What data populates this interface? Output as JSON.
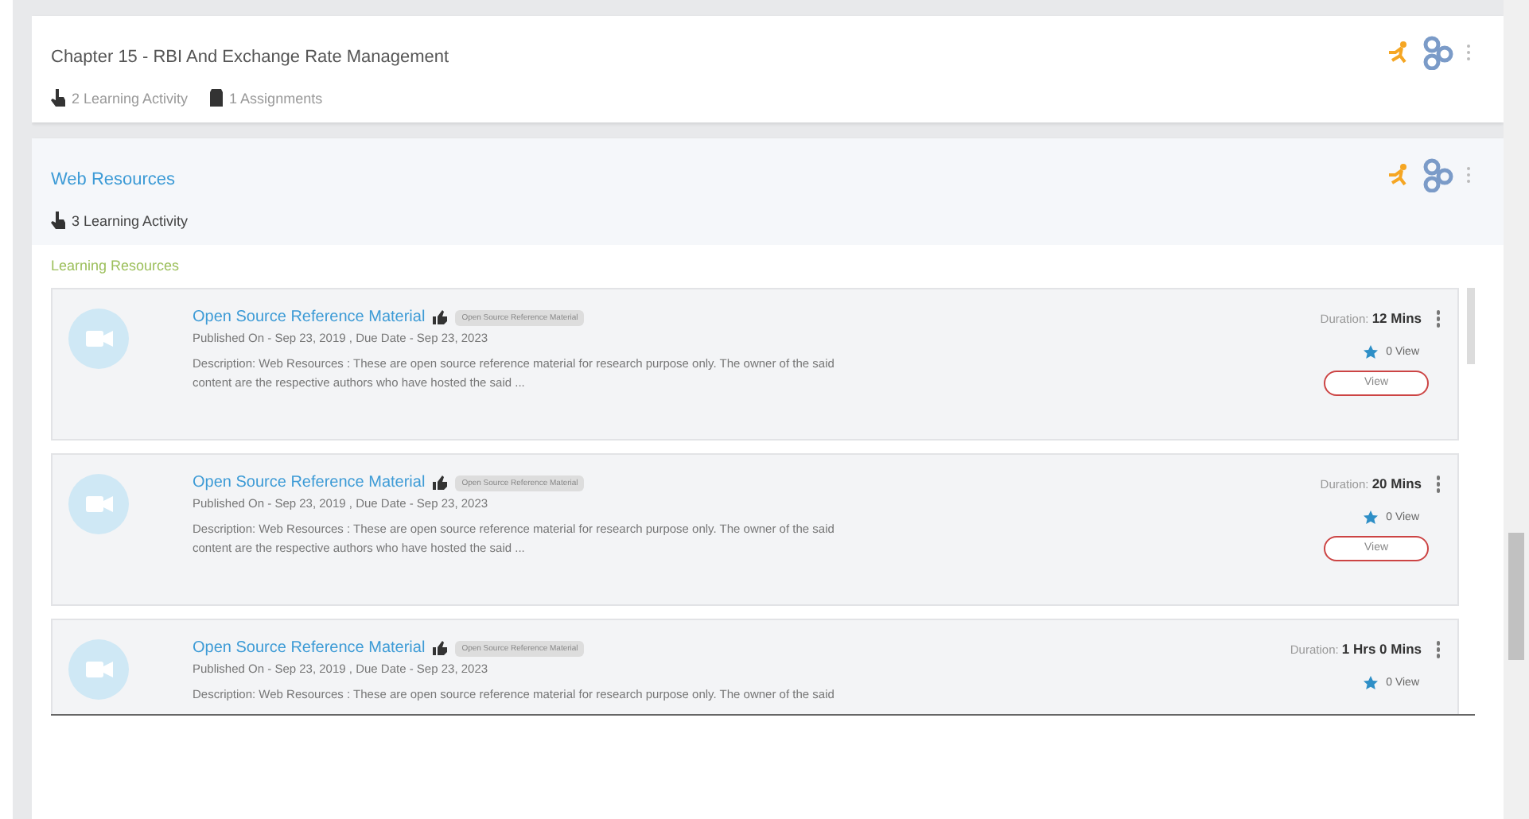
{
  "chapters": [
    {
      "title": "Chapter 15 - RBI And Exchange Rate Management",
      "kind": "plain",
      "stats": [
        {
          "kind": "activity",
          "text": "2 Learning Activity"
        },
        {
          "kind": "assignment",
          "text": "1 Assignments"
        }
      ]
    },
    {
      "title": "Web Resources",
      "kind": "expanded",
      "stats": [
        {
          "kind": "activity",
          "text": "3 Learning Activity"
        }
      ],
      "section_label": "Learning Resources",
      "resources": [
        {
          "title": "Open Source Reference Material",
          "tag": "Open Source Reference Material",
          "dates": "Published On - Sep 23, 2019 , Due Date - Sep 23, 2023",
          "description": "Description: Web Resources : These are open source reference material for research purpose only. The owner of the said content are the respective authors who have hosted the said ...",
          "duration_label": "Duration:",
          "duration": "12 Mins",
          "views": "0 View",
          "button": "View"
        },
        {
          "title": "Open Source Reference Material",
          "tag": "Open Source Reference Material",
          "dates": "Published On - Sep 23, 2019 , Due Date - Sep 23, 2023",
          "description": "Description: Web Resources : These are open source reference material for research purpose only. The owner of the said content are the respective authors who have hosted the said ...",
          "duration_label": "Duration:",
          "duration": "20 Mins",
          "views": "0 View",
          "button": "View"
        },
        {
          "title": "Open Source Reference Material",
          "tag": "Open Source Reference Material",
          "dates": "Published On - Sep 23, 2019 , Due Date - Sep 23, 2023",
          "description": "Description: Web Resources : These are open source reference material for research purpose only. The owner of the said",
          "duration_label": "Duration:",
          "duration": "1 Hrs 0 Mins",
          "views": "0 View"
        }
      ]
    }
  ]
}
